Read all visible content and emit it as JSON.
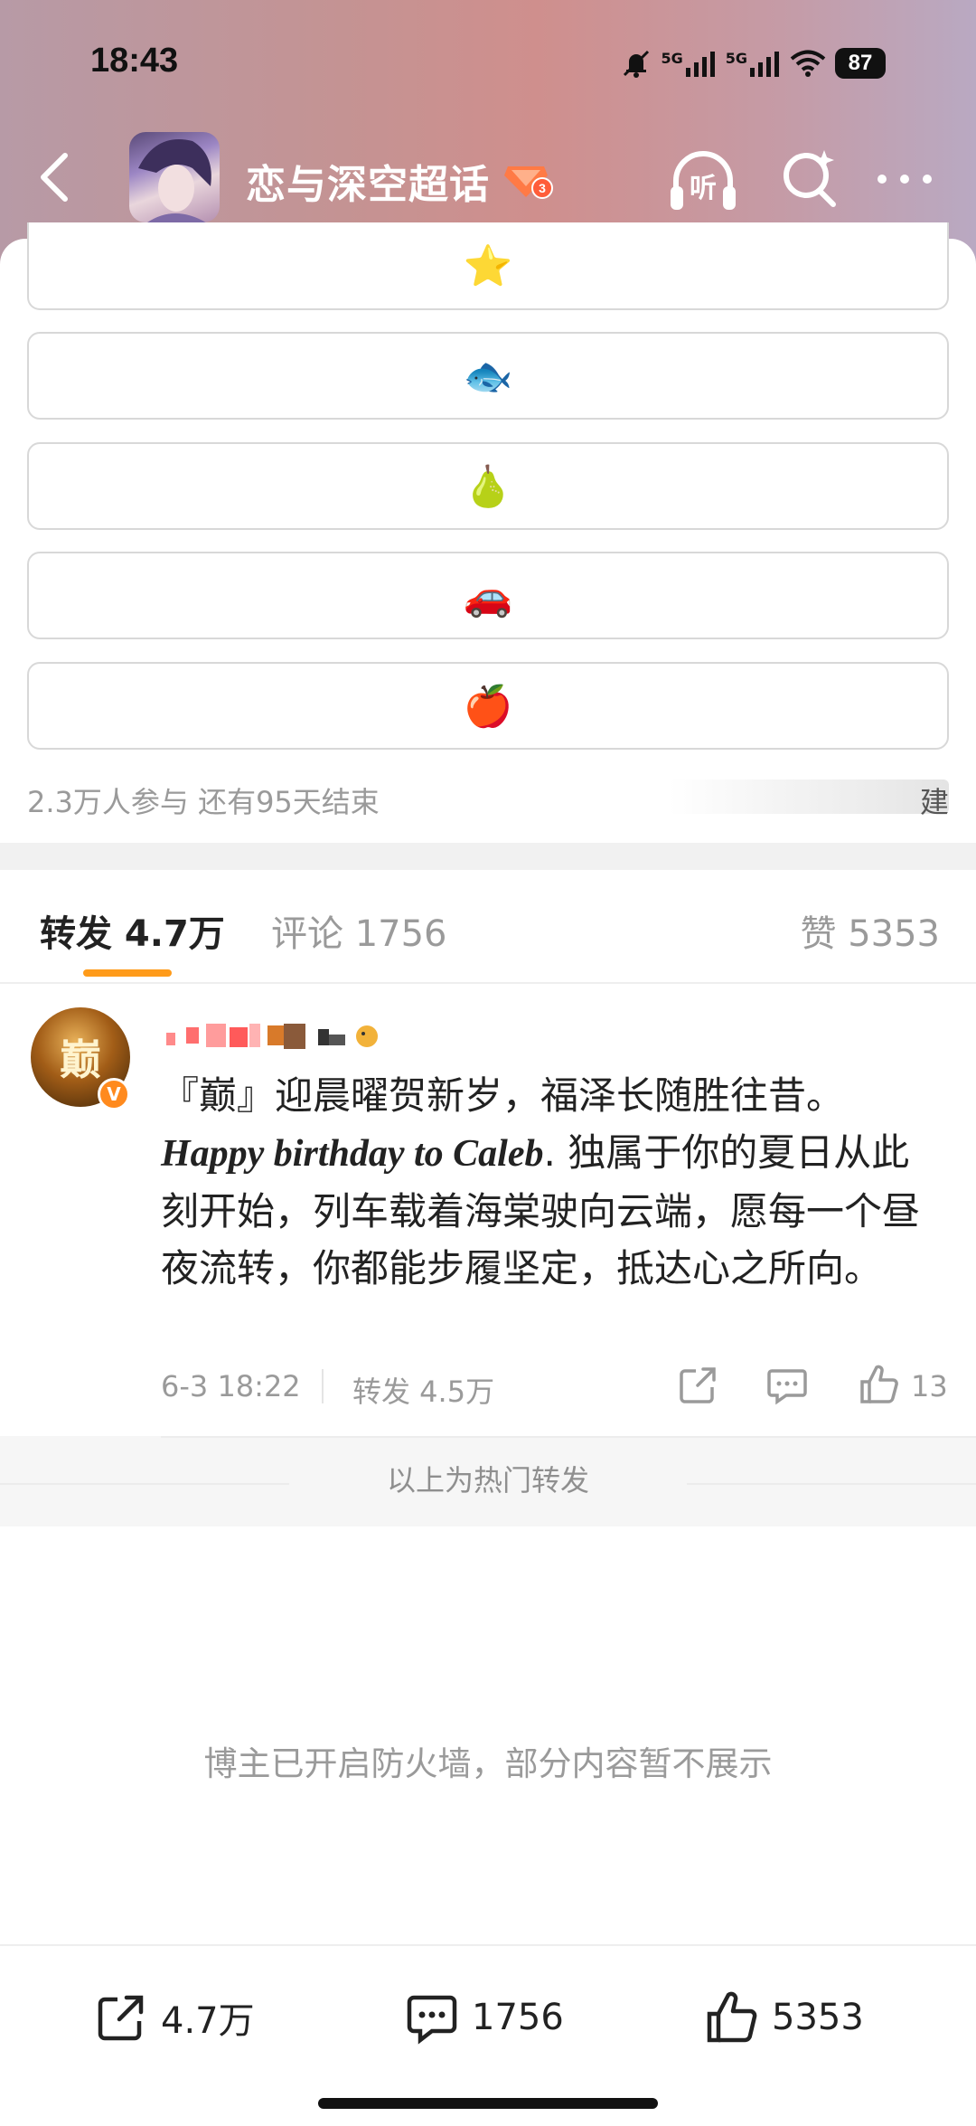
{
  "status_bar": {
    "time": "18:43",
    "network_1": "5G",
    "network_2": "5G",
    "battery": "87"
  },
  "nav": {
    "title": "恋与深空超话",
    "badge_level": "3",
    "listen_label": "听"
  },
  "poll": {
    "options": [
      "⭐",
      "🐟",
      "🍐",
      "🚗",
      "🍎"
    ],
    "meta": "2.3万人参与  还有95天结束",
    "hidden_tail": "建"
  },
  "tabs": {
    "repost": "转发 4.7万",
    "comment": "评论 1756",
    "like": "赞 5353"
  },
  "post": {
    "avatar_char": "巅",
    "verified": "V",
    "line1": "『巅』迎晨曜贺新岁，福泽长随胜往昔。",
    "english": "Happy birthday to Caleb",
    "rest": ". 独属于你的夏日从此刻开始，列车载着海棠驶向云端，愿每一个昼夜流转，你都能步履坚定，抵达心之所向。",
    "time": "6-3 18:22",
    "repost": "转发 4.5万",
    "like_count": "13"
  },
  "hot_label": "以上为热门转发",
  "firewall_notice": "博主已开启防火墙，部分内容暂不展示",
  "bottom_bar": {
    "share_count": "4.7万",
    "comment_count": "1756",
    "like_count": "5353"
  },
  "colors": {
    "accent": "#ff9b1a",
    "verified": "#ff8a1e",
    "muted_text": "#9a9a9a"
  }
}
